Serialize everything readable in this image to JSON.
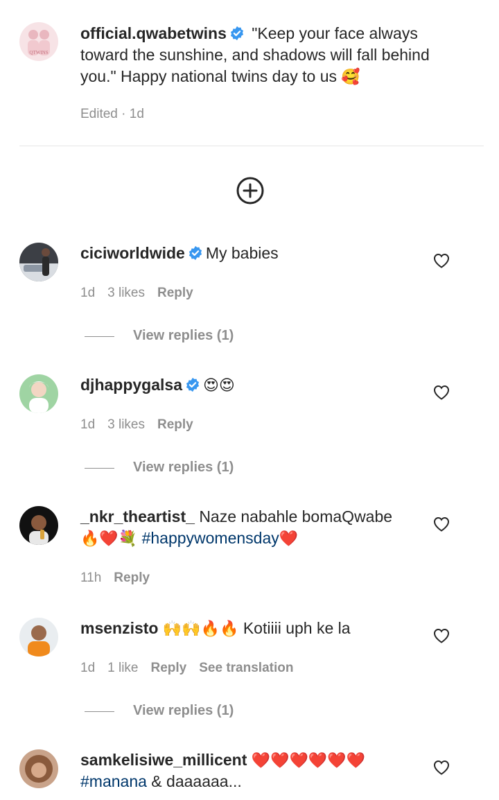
{
  "caption": {
    "username": "official.qwabetwins",
    "text": " \"Keep your face always toward the sunshine, and shadows will fall behind you.\" Happy national twins day to us ",
    "emoji": "🥰",
    "meta": "Edited · 1d",
    "avatar_text": "QTWINS"
  },
  "add_icon": "plus-circle-icon",
  "comments": [
    {
      "username": "ciciworldwide",
      "verified": true,
      "text": "My babies",
      "time": "1d",
      "likes": "3 likes",
      "reply": "Reply",
      "view_replies": "View replies (1)"
    },
    {
      "username": "djhappygalsa",
      "verified": true,
      "text": "😍😍",
      "time": "1d",
      "likes": "3 likes",
      "reply": "Reply",
      "view_replies": "View replies (1)"
    },
    {
      "username": "_nkr_theartist_",
      "verified": false,
      "text": "Naze nabahle bomaQwabe",
      "emojis": "🔥❤️💐",
      "hashtag": "#happywomensday",
      "end_emoji": "❤️",
      "time": "11h",
      "reply": "Reply"
    },
    {
      "username": "msenzisto",
      "verified": false,
      "emojis": "🙌🙌🔥🔥",
      "text": "Kotiiii uph ke la",
      "time": "1d",
      "likes": "1 like",
      "reply": "Reply",
      "translation": "See translation",
      "view_replies": "View replies (1)"
    },
    {
      "username": "samkelisiwe_millicent",
      "verified": false,
      "emojis": "❤️❤️❤️❤️❤️❤️",
      "hashtag": "#manana",
      "text": " & daaaaaa..."
    }
  ],
  "colors": {
    "text": "#262626",
    "muted": "#8e8e8e",
    "verified": "#3897f0",
    "hashtag": "#00376b"
  }
}
